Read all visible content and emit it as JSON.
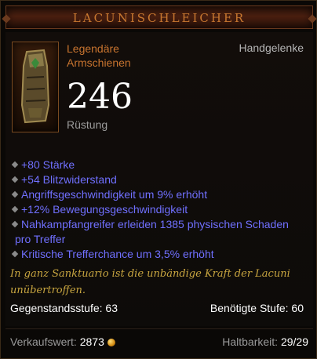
{
  "tooltip": {
    "title": "LACUNISCHLEICHER",
    "item_type_line1": "Legendäre",
    "item_type_line2": "Armschienen",
    "slot": "Handgelenke",
    "armor_value": "246",
    "armor_label": "Rüstung",
    "stats": [
      "+80 Stärke",
      "+54 Blitzwiderstand",
      "Angriffsgeschwindigkeit um 9% erhöht",
      "+12% Bewegungsgeschwindigkeit",
      "Nahkampfangreifer erleiden 1385 physischen Schaden",
      "pro Treffer",
      "Kritische Trefferchance um 3,5% erhöht"
    ],
    "flavor_line1": "In ganz Sanktuario ist die unbändige Kraft der Lacuni",
    "flavor_line2": "unübertroffen.",
    "item_level_label": "Gegenstandsstufe: 63",
    "required_level_label": "Benötigte Stufe: 60",
    "sell_label": "Verkaufswert:",
    "sell_value": "2873",
    "durability_label": "Haltbarkeit:",
    "durability_value": "29/29"
  },
  "colors": {
    "title": "#c87830",
    "legendary": "#c8742f",
    "magic_stat": "#7070ff",
    "flavor": "#c9a640"
  },
  "icons": {
    "item": "bracer-item-icon",
    "currency": "gold-coin-icon"
  }
}
